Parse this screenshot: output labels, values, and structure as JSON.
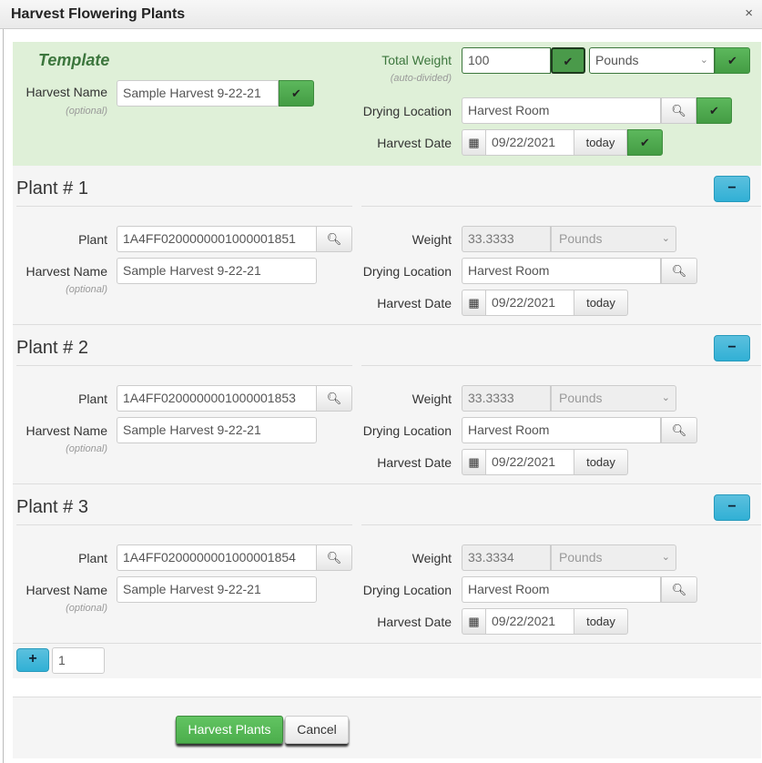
{
  "dialog": {
    "title": "Harvest Flowering Plants",
    "close_label": "×"
  },
  "template": {
    "heading": "Template",
    "harvest_name_label": "Harvest Name",
    "optional_hint": "(optional)",
    "harvest_name_value": "Sample Harvest 9-22-21",
    "total_weight_label": "Total Weight",
    "auto_divided_hint": "(auto-divided)",
    "total_weight_value": "100",
    "unit_value": "Pounds",
    "drying_location_label": "Drying Location",
    "drying_location_value": "Harvest Room",
    "harvest_date_label": "Harvest Date",
    "harvest_date_value": "09/22/2021",
    "today_label": "today"
  },
  "labels": {
    "plant": "Plant",
    "harvest_name": "Harvest Name",
    "optional": "(optional)",
    "weight": "Weight",
    "drying_location": "Drying Location",
    "harvest_date": "Harvest Date",
    "today": "today",
    "remove": "−"
  },
  "plants": [
    {
      "title": "Plant # 1",
      "plant_id": "1A4FF0200000001000001851",
      "harvest_name": "Sample Harvest 9-22-21",
      "weight": "33.3333",
      "unit": "Pounds",
      "drying_location": "Harvest Room",
      "harvest_date": "09/22/2021"
    },
    {
      "title": "Plant # 2",
      "plant_id": "1A4FF0200000001000001853",
      "harvest_name": "Sample Harvest 9-22-21",
      "weight": "33.3333",
      "unit": "Pounds",
      "drying_location": "Harvest Room",
      "harvest_date": "09/22/2021"
    },
    {
      "title": "Plant # 3",
      "plant_id": "1A4FF0200000001000001854",
      "harvest_name": "Sample Harvest 9-22-21",
      "weight": "33.3334",
      "unit": "Pounds",
      "drying_location": "Harvest Room",
      "harvest_date": "09/22/2021"
    }
  ],
  "add_row": {
    "plus_label": "+",
    "count_value": "1"
  },
  "footer": {
    "submit_label": "Harvest Plants",
    "cancel_label": "Cancel"
  },
  "colors": {
    "template_bg": "#dff0d8",
    "success": "#5cb85c",
    "info": "#5bc0de"
  }
}
